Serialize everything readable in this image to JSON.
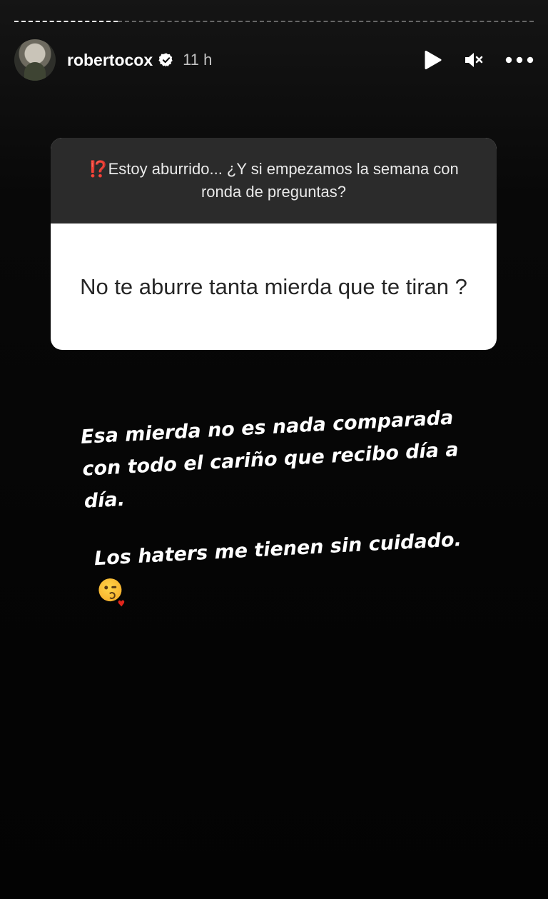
{
  "header": {
    "username": "robertocox",
    "time": "11 h"
  },
  "question": {
    "prefix_icon": "⁉️",
    "text": "Estoy aburrido... ¿Y si empezamos la semana con ronda de preguntas?"
  },
  "answer": {
    "text": "No te aburre tanta mierda que te tiran ?"
  },
  "reply": {
    "paragraph1": "Esa mierda no es nada comparada con todo el cariño que recibo día a día.",
    "paragraph2": "Los haters me tienen sin cuidado.",
    "emoji": "kissing-heart-emoji"
  },
  "icons": {
    "verified": "verified-badge-icon",
    "play": "play-icon",
    "mute": "muted-speaker-icon",
    "more": "more-options-icon"
  },
  "colors": {
    "background": "#050505",
    "question_bg": "#2b2b2b",
    "answer_bg": "#ffffff",
    "accent": "#e6362f"
  }
}
